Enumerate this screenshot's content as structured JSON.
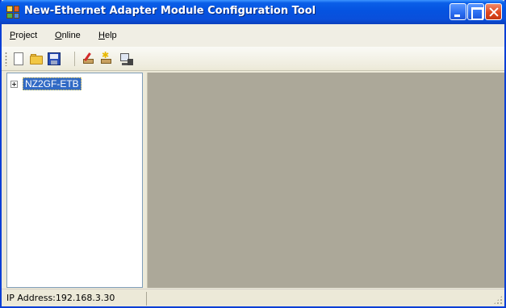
{
  "window": {
    "title": "New-Ethernet Adapter Module Configuration Tool",
    "accent_color": "#0a5ee8"
  },
  "menu": {
    "items": [
      {
        "hotkey": "P",
        "rest": "roject"
      },
      {
        "hotkey": "O",
        "rest": "nline"
      },
      {
        "hotkey": "H",
        "rest": "elp"
      }
    ]
  },
  "toolbar": {
    "icons": [
      "new-file-icon",
      "open-folder-icon",
      "save-disk-icon",
      "write-to-module-icon",
      "write-star-icon",
      "monitor-icon"
    ]
  },
  "tree": {
    "root": {
      "label": "NZ2GF-ETB",
      "expanded": false,
      "selected": true
    }
  },
  "status": {
    "text": "IP Address:192.168.3.30"
  }
}
